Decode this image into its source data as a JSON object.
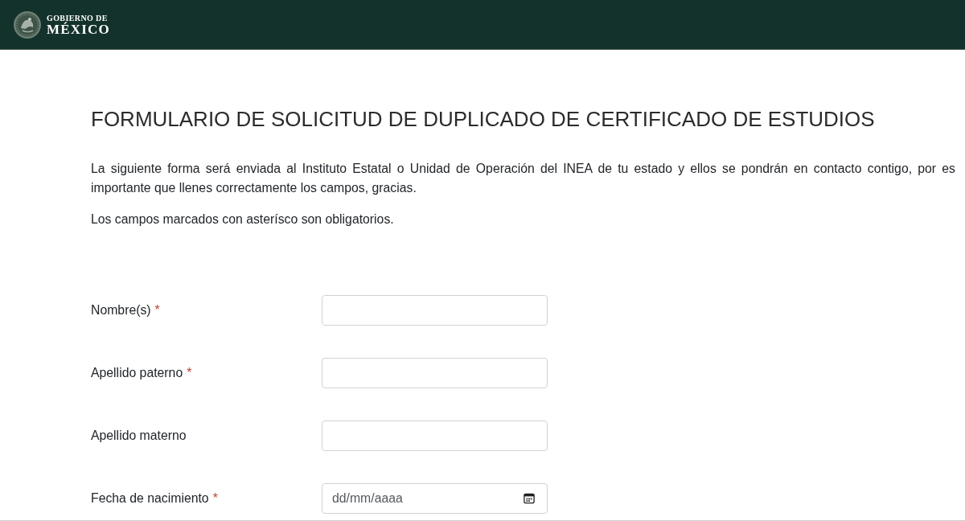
{
  "header": {
    "logo": {
      "line_1": "GOBIERNO DE",
      "line_2": "MÉXICO"
    }
  },
  "title": "FORMULARIO DE SOLICITUD DE DUPLICADO DE CERTIFICADO DE ESTUDIOS",
  "intro": [
    "La siguiente forma será enviada al Instituto Estatal o Unidad de Operación del INEA de tu estado y ellos se pondrán en contacto contigo, por es importante que llenes correctamente los campos, gracias.",
    "Los campos marcados con asterísco son obligatorios."
  ],
  "form": {
    "required_mark": "*",
    "fields": [
      {
        "label": "Nombre(s)",
        "kind": "text",
        "required": true
      },
      {
        "label": "Apellido paterno",
        "kind": "text",
        "required": true
      },
      {
        "label": "Apellido materno",
        "kind": "text",
        "required": false
      },
      {
        "label": "Fecha de nacimiento",
        "kind": "date",
        "required": true,
        "placeholder": "dd/mm/aaaa"
      }
    ]
  }
}
